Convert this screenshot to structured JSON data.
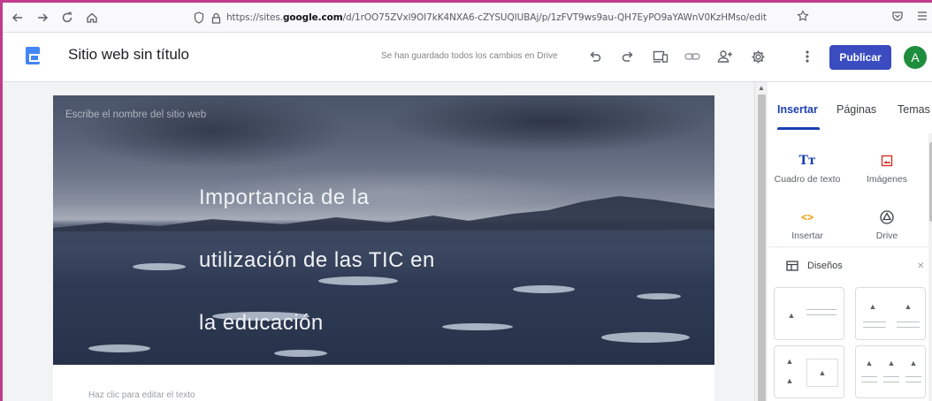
{
  "browser": {
    "url_prefix": "https://sites.",
    "url_domain": "google.com",
    "url_path": "/d/1rOO75ZVxl9OI7kK4NXA6-cZYSUQIUBAj/p/1zFVT9ws9au-QH7EyPO9aYAWnV0KzHMso/edit"
  },
  "header": {
    "site_title": "Sitio web sin título",
    "save_status": "Se han guardado todos los cambios en Drive",
    "publish_label": "Publicar",
    "avatar_letter": "A"
  },
  "canvas": {
    "site_name_placeholder": "Escribe el nombre del sitio web",
    "hero_title_lines": [
      "Importancia de la",
      "utilización de las TIC en",
      "la educación"
    ],
    "edit_hint": "Haz clic para editar el texto"
  },
  "panel": {
    "tabs": [
      "Insertar",
      "Páginas",
      "Temas"
    ],
    "insert_items": [
      {
        "label": "Cuadro de texto",
        "icon": "text-box-icon",
        "glyph": "Tт",
        "color": "#1a3fb3"
      },
      {
        "label": "Imágenes",
        "icon": "image-icon",
        "glyph": "▣",
        "color": "#d93025"
      },
      {
        "label": "Insertar",
        "icon": "embed-icon",
        "glyph": "<>",
        "color": "#f29900"
      },
      {
        "label": "Drive",
        "icon": "drive-icon",
        "glyph": "△",
        "color": "#3c4043"
      }
    ],
    "layouts_label": "Diseños"
  },
  "colors": {
    "accent": "#1a3fb3",
    "publish": "#3b4cc0",
    "avatar": "#1e8e3e",
    "frame": "#c03b8d"
  }
}
